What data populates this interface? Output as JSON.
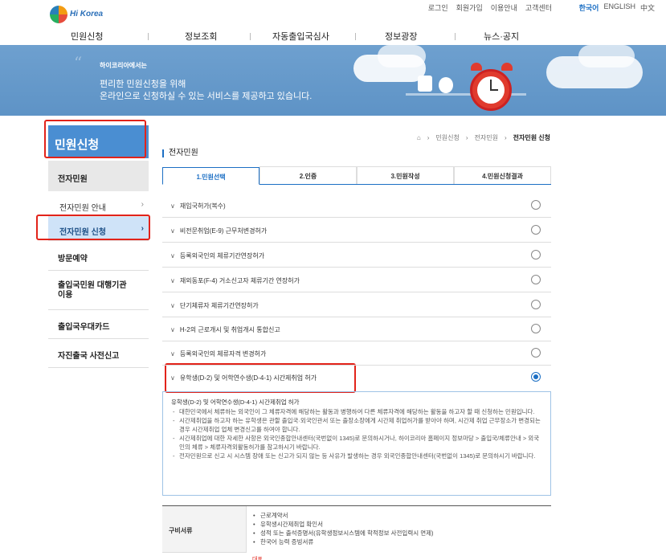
{
  "header": {
    "logo_text": "Hi Korea",
    "util_links": [
      "로그인",
      "회원가입",
      "이용안내",
      "고객센터"
    ],
    "lang_links": [
      "한국어",
      "ENGLISH",
      "中文"
    ]
  },
  "gnb": [
    "민원신청",
    "정보조회",
    "자동출입국심사",
    "정보광장",
    "뉴스·공지"
  ],
  "banner": {
    "small": "하이코리아에서는",
    "line1": "편리한 민원신청을 위해",
    "line2": "온라인으로 신청하실 수 있는 서비스를 제공하고 있습니다."
  },
  "sidebar": {
    "title": "민원신청",
    "group1": "전자민원",
    "sub1": "전자민원 안내",
    "sub2": "전자민원 신청",
    "items": [
      "방문예약",
      "출입국민원 대행기관 이용",
      "출입국우대카드",
      "자진출국 사전신고"
    ]
  },
  "breadcrumb": [
    "민원신청",
    "전자민원",
    "전자민원 신청"
  ],
  "section_title": "전자민원",
  "tabs": [
    "1.민원선택",
    "2.인증",
    "3.민원작성",
    "4.민원신청결과"
  ],
  "rows": [
    "재입국허가(복수)",
    "비전문취업(E-9) 근무처변경허가",
    "등록외국인의 체류기간연장허가",
    "재외동포(F-4) 거소신고자 체류기간 연장허가",
    "단기체류자 체류기간연장허가",
    "H-2의 근로개시 및 취업개시 통합신고",
    "등록외국인의 체류자격 변경허가",
    "유학생(D-2) 및 어학연수생(D-4-1) 시간제취업 허가"
  ],
  "selected_row_index": 7,
  "info": {
    "title": "유학생(D-2) 및 어학연수생(D-4-1) 시간제취업 허가",
    "bullets": [
      "대한민국에서 체류하는 외국인이 그 체류자격에 해당하는 활동과 병행하여 다른 체류자격에 해당하는 활동을 하고자 할 때 신청하는 민원입니다.",
      "시간제취업을 하고자 하는 유학생은 관할 출입국·외국인관서 또는 출장소장에게 시간제 취업허가를 받아야 하며, 시간제 취업 근무장소가 변경되는 경우 시간제취업 업체 변경신고를 하여야 합니다.",
      "시간제취업에 대한 자세한 사항은 외국인종합안내센터(국번없이 1345)로 문의하시거나, 하이코리아 홈페이지 정보마당 > 출입국/체류안내 > 외국인의 체류 > 체류자격외활동허가를 참고하시기 바랍니다.",
      "전자민원으로 신고 시 시스템 장애 또는 신고가 되지 않는 등 사유가 발생하는 경우 외국인종합안내센터(국번없이 1345)로 문의하시기 바랍니다."
    ]
  },
  "documents": {
    "header": "구비서류",
    "items": [
      "근로계약서",
      "유학생시간제취업 확인서",
      "성적 또는 출석증명서(유학생정보시스템에 학적정보 사전입력시 면제)",
      "한국어 능력 증빙서류"
    ],
    "next_label": "대표"
  },
  "colors": {
    "accent": "#1c6fc4",
    "banner": "#6ea0cf",
    "highlight": "#e2231a",
    "sidebar_title": "#4a8ed2"
  }
}
